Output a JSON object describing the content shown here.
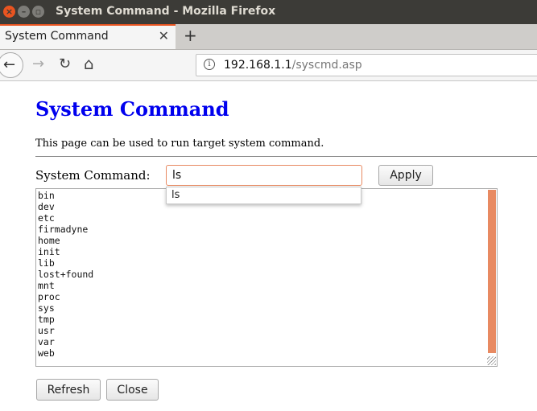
{
  "window": {
    "title": "System Command - Mozilla Firefox"
  },
  "tab": {
    "title": "System Command",
    "close_glyph": "✕",
    "new_tab_glyph": "+"
  },
  "nav": {
    "back_glyph": "←",
    "forward_glyph": "→",
    "reload_glyph": "↻",
    "home_glyph": "⌂",
    "info_glyph": "i",
    "url_host": "192.168.1.1",
    "url_path": "/syscmd.asp"
  },
  "page": {
    "title": "System Command",
    "description": "This page can be used to run target system command.",
    "command_label": "System Command:",
    "command_value": "ls",
    "apply_label": "Apply",
    "autocomplete": [
      "ls"
    ],
    "output_lines": [
      "bin",
      "dev",
      "etc",
      "firmadyne",
      "home",
      "init",
      "lib",
      "lost+found",
      "mnt",
      "proc",
      "sys",
      "tmp",
      "usr",
      "var",
      "web"
    ],
    "refresh_label": "Refresh",
    "close_label": "Close"
  },
  "colors": {
    "accent": "#e95420",
    "link_title": "#0000ee",
    "scrollbar": "#e88a62"
  }
}
